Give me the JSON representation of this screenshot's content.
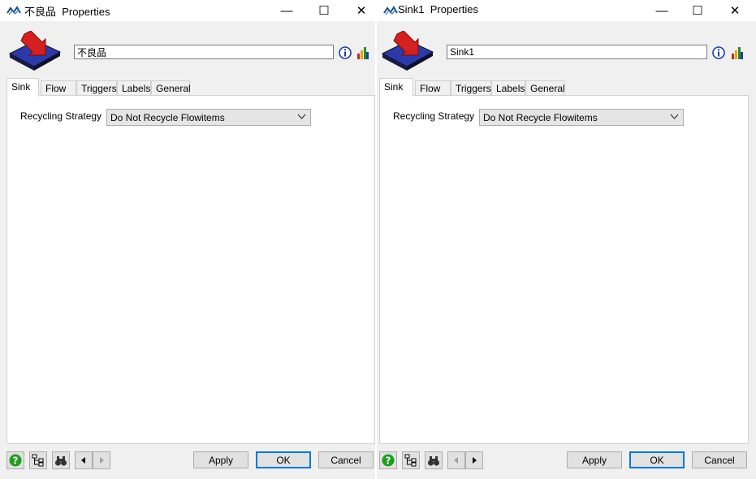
{
  "windows": [
    {
      "title_name": "不良品",
      "title_suffix": "Properties",
      "object_name": "不良品",
      "tabs": [
        "Sink",
        "Flow",
        "Triggers",
        "Labels",
        "General"
      ],
      "active_tab": "Sink",
      "recycling_label": "Recycling Strategy",
      "recycling_value": "Do Not Recycle Flowitems",
      "buttons": {
        "apply": "Apply",
        "ok": "OK",
        "cancel": "Cancel"
      }
    },
    {
      "title_name": "Sink1",
      "title_suffix": "Properties",
      "object_name": "Sink1",
      "tabs": [
        "Sink",
        "Flow",
        "Triggers",
        "Labels",
        "General"
      ],
      "active_tab": "Sink",
      "recycling_label": "Recycling Strategy",
      "recycling_value": "Do Not Recycle Flowitems",
      "buttons": {
        "apply": "Apply",
        "ok": "OK",
        "cancel": "Cancel"
      }
    }
  ],
  "caption_glyphs": {
    "minimize": "—",
    "maximize": "☐",
    "close": "✕"
  },
  "icons": [
    "app-icon",
    "sink-object-icon",
    "info-icon",
    "statistics-icon",
    "help-icon",
    "tree-icon",
    "find-icon",
    "back-arrow-icon",
    "forward-arrow-icon",
    "chevron-down-icon"
  ],
  "colors": {
    "accent": "#0078d7",
    "help_green": "#1e9e1e",
    "sink_blue": "#2b3aa8",
    "sink_arrow_red": "#d42020"
  }
}
